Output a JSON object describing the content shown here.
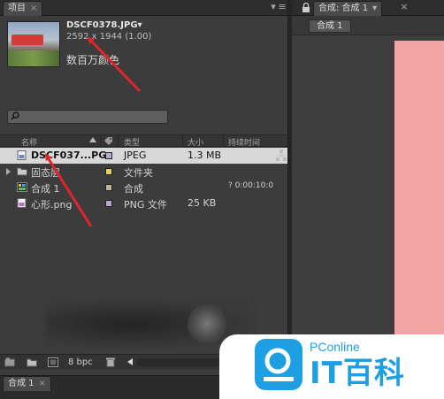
{
  "project_panel": {
    "tab_label": "项目",
    "menu_glyph": "▾≡"
  },
  "preview": {
    "file_name": "DSCF0378.JPG▾",
    "dimensions": "2592 x 1944 (1.00)",
    "colors": "数百万颜色"
  },
  "search": {
    "placeholder": ""
  },
  "columns": {
    "name": "名称",
    "type": "类型",
    "size": "大小",
    "duration": "持续时间"
  },
  "files": [
    {
      "name": "DSCF037...PG",
      "type": "JPEG",
      "size": "1.3 MB",
      "duration": "",
      "label_color": "#b8a6d0",
      "icon": "image-file-icon",
      "selected": true
    },
    {
      "name": "固态层",
      "type": "文件夹",
      "size": "",
      "duration": "",
      "label_color": "#e2d45a",
      "icon": "folder-icon",
      "selected": false,
      "expandable": true
    },
    {
      "name": "合成 1",
      "type": "合成",
      "size": "",
      "duration": "? 0:00:10:0",
      "label_color": "#bfb29a",
      "icon": "composition-icon",
      "selected": false
    },
    {
      "name": "心形.png",
      "type": "PNG 文件",
      "size": "25 KB",
      "duration": "",
      "label_color": "#b8a6d0",
      "icon": "image-file-icon",
      "selected": false
    }
  ],
  "bottom_toolbar": {
    "bpc": "8 bpc"
  },
  "composition_panel": {
    "tab_label": "合成: 合成 1",
    "breadcrumb": "合成 1",
    "canvas_color": "#f4a3a3"
  },
  "timeline": {
    "tab_label": "合成 1"
  },
  "watermark": {
    "brand": "PConline",
    "title": "IT百科"
  },
  "colors": {
    "panel_bg": "#3c3c3c",
    "selected_row": "#d8d8d8",
    "annotation_arrow": "#e0242c",
    "watermark_blue": "#1e9fe3"
  }
}
